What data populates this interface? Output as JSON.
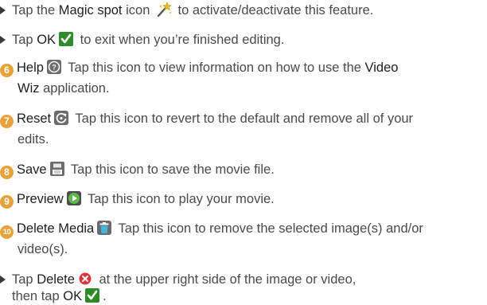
{
  "items": {
    "magic_spot": {
      "pre": "Tap the ",
      "bold": "Magic spot",
      "mid": " icon ",
      "post": " to activate/deactivate this feature.",
      "icon": "magic-wand-icon"
    },
    "ok_exit": {
      "pre": "Tap ",
      "bold": "OK",
      "post": " to exit when you’re finished editing.",
      "icon": "checkmark-icon"
    },
    "help": {
      "number": "6",
      "title": "Help",
      "text_a": " Tap this icon to view information on how to use the ",
      "bold_a": "Video",
      "bold_b": "Wiz",
      "text_b": " application.",
      "icon": "help-icon"
    },
    "reset": {
      "number": "7",
      "title": "Reset",
      "text_a": " Tap this icon to revert to the default and remove all of your",
      "text_b": "edits.",
      "icon": "reset-icon"
    },
    "save": {
      "number": "8",
      "title": "Save",
      "text": " Tap this icon to save the movie file.",
      "icon": "save-icon"
    },
    "preview": {
      "number": "9",
      "title": "Preview",
      "text": " Tap this icon to play your movie.",
      "icon": "play-icon"
    },
    "delete_media": {
      "number": "10",
      "title": "Delete Media",
      "text_a": " Tap this icon to remove the selected image(s) and/or",
      "text_b": "video(s).",
      "icon": "trash-icon"
    },
    "delete_tap": {
      "pre": "Tap ",
      "bold": "Delete",
      "post": " at the upper right side of the image or video,",
      "line2_pre": "then tap ",
      "line2_bold": "OK",
      "line2_post": ".",
      "icon": "delete-x-icon",
      "icon2": "checkmark-icon"
    }
  },
  "colors": {
    "number_badge": "#e9a23a",
    "check_green": "#3a9a2e",
    "delete_red": "#d9373b",
    "text": "#4a4a4a",
    "bold_text": "#1e1e1e"
  }
}
